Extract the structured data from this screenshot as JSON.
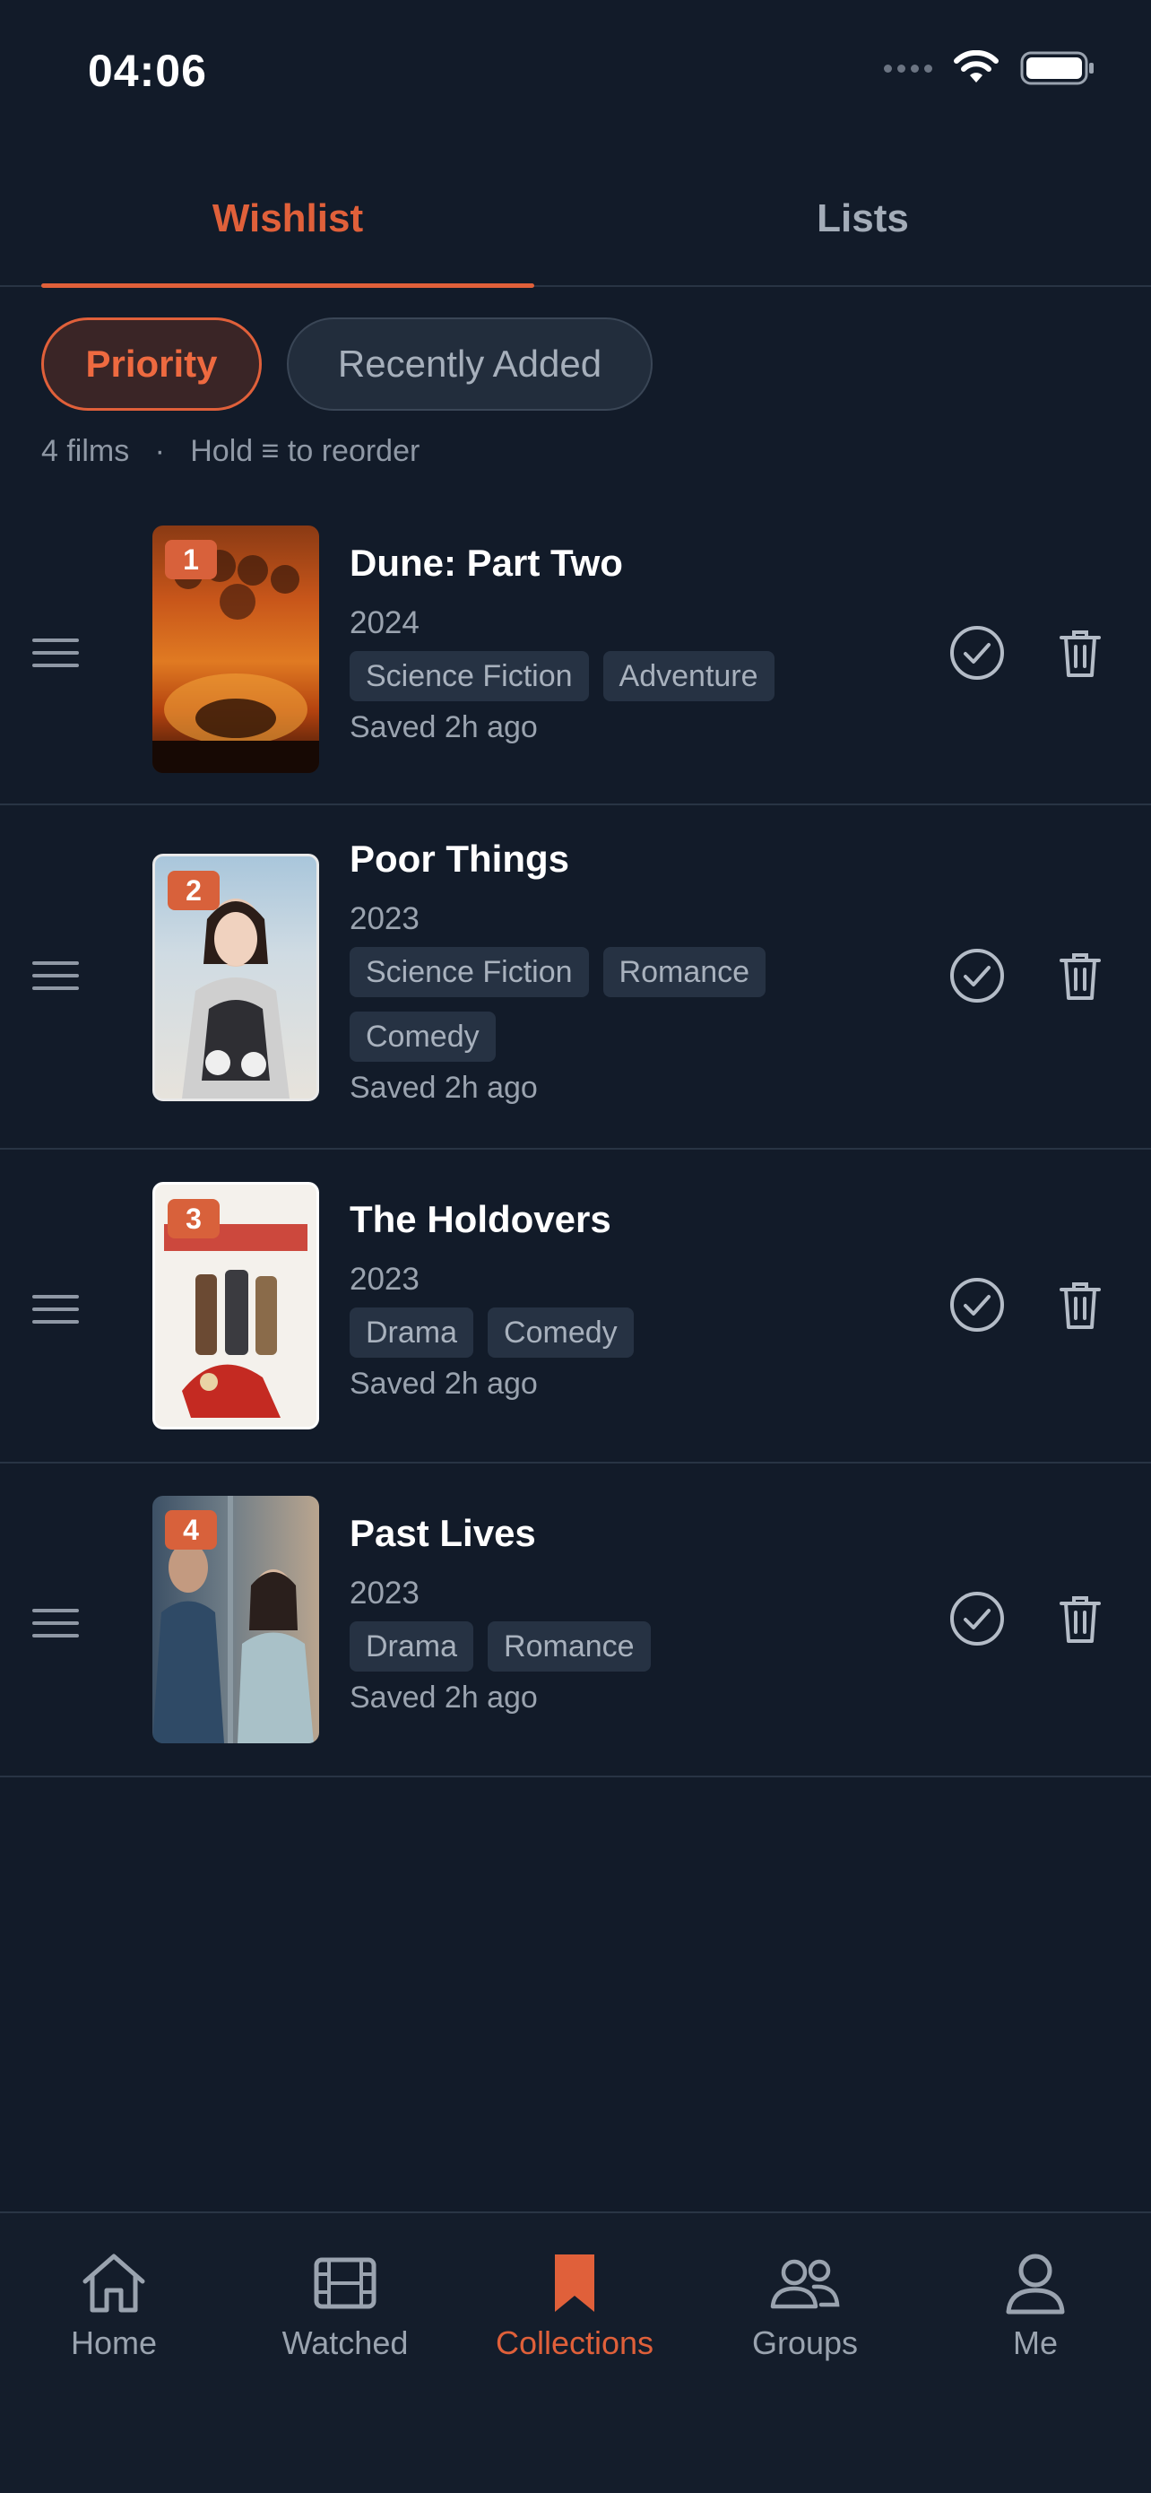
{
  "status_bar": {
    "time": "04:06"
  },
  "tabs": {
    "wishlist": "Wishlist",
    "lists": "Lists",
    "active": "Wishlist"
  },
  "sort_chips": {
    "priority": "Priority",
    "recently_added": "Recently Added",
    "selected": "Priority"
  },
  "meta": {
    "count": "4 films",
    "separator": "·",
    "hint": "Hold ≡ to reorder"
  },
  "films": [
    {
      "rank": "1",
      "title": "Dune: Part Two",
      "year": "2024",
      "genres": [
        "Science Fiction",
        "Adventure"
      ],
      "saved": "Saved 2h ago"
    },
    {
      "rank": "2",
      "title": "Poor Things",
      "year": "2023",
      "genres": [
        "Science Fiction",
        "Romance",
        "Comedy"
      ],
      "saved": "Saved 2h ago"
    },
    {
      "rank": "3",
      "title": "The Holdovers",
      "year": "2023",
      "genres": [
        "Drama",
        "Comedy"
      ],
      "saved": "Saved 2h ago"
    },
    {
      "rank": "4",
      "title": "Past Lives",
      "year": "2023",
      "genres": [
        "Drama",
        "Romance"
      ],
      "saved": "Saved 2h ago"
    }
  ],
  "tab_bar": {
    "home": "Home",
    "watched": "Watched",
    "collections": "Collections",
    "groups": "Groups",
    "me": "Me",
    "active": "Collections"
  },
  "colors": {
    "accent": "#e0603a",
    "background": "#121b29",
    "chip_bg": "#263243"
  }
}
